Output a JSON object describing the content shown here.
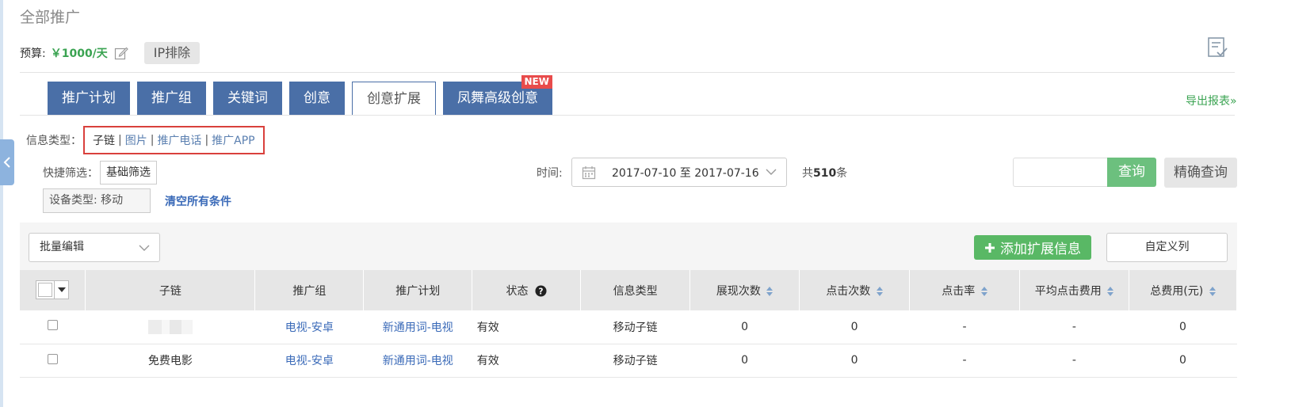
{
  "page": {
    "title": "全部推广"
  },
  "budget": {
    "label": "预算:",
    "value": "￥1000/天",
    "ip_button": "IP排除"
  },
  "tabs": [
    {
      "label": "推广计划",
      "active": false
    },
    {
      "label": "推广组",
      "active": false
    },
    {
      "label": "关键词",
      "active": false
    },
    {
      "label": "创意",
      "active": false
    },
    {
      "label": "创意扩展",
      "active": true
    },
    {
      "label": "凤舞高级创意",
      "active": false,
      "badge": "NEW"
    }
  ],
  "export_link": "导出报表»",
  "info_type": {
    "label": "信息类型：",
    "current": "子链",
    "sep": "|",
    "links": [
      "图片",
      "推广电话",
      "推广APP"
    ]
  },
  "filters": {
    "quick_label": "快捷筛选：",
    "quick_value": "基础筛选",
    "device": "设备类型: 移动",
    "clear": "清空所有条件"
  },
  "time": {
    "label": "时间:",
    "range": "2017-07-10 至 2017-07-16"
  },
  "count": {
    "prefix": "共",
    "value": "510",
    "suffix": "条"
  },
  "search": {
    "placeholder": "",
    "button": "查询",
    "precise": "精确查询"
  },
  "toolbar": {
    "batch_edit": "批量编辑",
    "add": "添加扩展信息",
    "custom_columns": "自定义列"
  },
  "table": {
    "headers": [
      "子链",
      "推广组",
      "推广计划",
      "状态",
      "信息类型",
      "展现次数",
      "点击次数",
      "点击率",
      "平均点击费用",
      "总费用(元)"
    ],
    "rows": [
      {
        "sublink": "",
        "group": "电视-安卓",
        "plan": "新通用词-电视",
        "status": "有效",
        "type": "移动子链",
        "impressions": "0",
        "clicks": "0",
        "ctr": "-",
        "avg_cpc": "-",
        "total": "0"
      },
      {
        "sublink": "免费电影",
        "group": "电视-安卓",
        "plan": "新通用词-电视",
        "status": "有效",
        "type": "移动子链",
        "impressions": "0",
        "clicks": "0",
        "ctr": "-",
        "avg_cpc": "-",
        "total": "0"
      }
    ]
  },
  "colors": {
    "tab_blue": "#4a6fa7",
    "green": "#59b865",
    "link_blue": "#3a6ab8",
    "highlight_red": "#d9403c"
  }
}
